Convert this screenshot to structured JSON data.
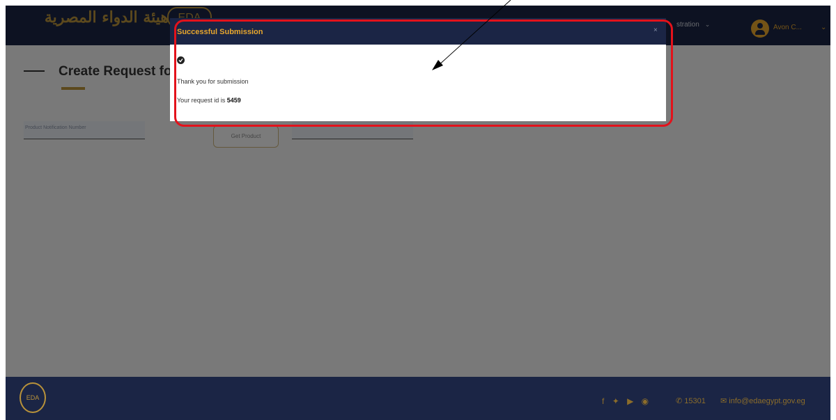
{
  "header": {
    "logo_text": "هيئة الدواء المصرية",
    "logo_mark": "EDA",
    "nav_partial": "stration",
    "user_name": "Avon C..."
  },
  "main": {
    "title": "Create Request for",
    "field1_label": "Product Notification Number",
    "get_product_label": "Get Product"
  },
  "modal": {
    "title": "Successful Submission",
    "close": "×",
    "message": "Thank you for submission",
    "request_prefix": "Your request id is",
    "request_id": "5459"
  },
  "footer": {
    "logo_mark": "EDA",
    "phone": "15301",
    "email": "info@edaegypt.gov.eg",
    "social_icons": [
      "facebook-icon",
      "twitter-icon",
      "youtube-icon",
      "instagram-icon"
    ]
  },
  "annotation": {
    "highlight_color": "#e3121b"
  }
}
